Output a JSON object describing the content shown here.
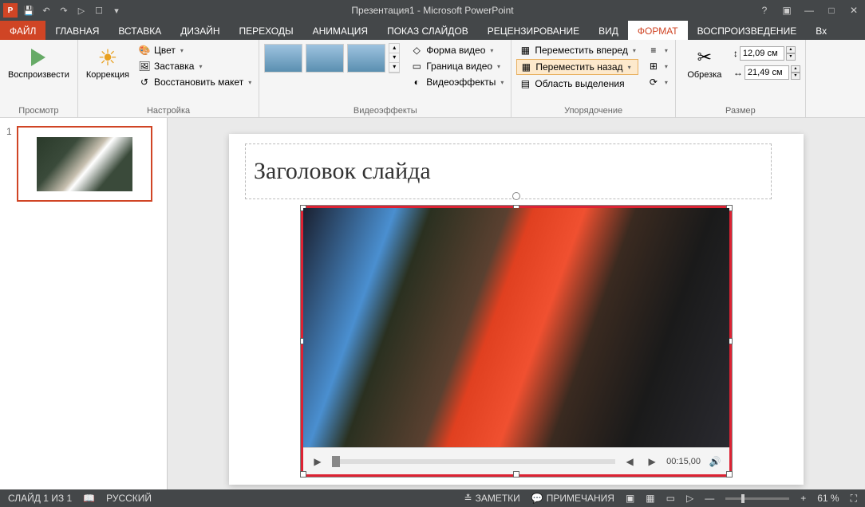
{
  "title": "Презентация1 - Microsoft PowerPoint",
  "qat": {
    "save": "💾",
    "undo": "↶",
    "redo": "↷",
    "start": "▷",
    "touch": "☐"
  },
  "tabs": [
    "ФАЙЛ",
    "ГЛАВНАЯ",
    "ВСТАВКА",
    "ДИЗАЙН",
    "ПЕРЕХОДЫ",
    "АНИМАЦИЯ",
    "ПОКАЗ СЛАЙДОВ",
    "РЕЦЕНЗИРОВАНИЕ",
    "ВИД",
    "ФОРМАТ",
    "ВОСПРОИЗВЕДЕНИЕ",
    "Вх"
  ],
  "active_tab": 9,
  "ribbon": {
    "group1": {
      "play": "Воспроизвести",
      "label": "Просмотр"
    },
    "group2": {
      "corrections": "Коррекция",
      "color": "Цвет",
      "poster": "Заставка",
      "reset": "Восстановить макет",
      "label": "Настройка"
    },
    "group3": {
      "shape": "Форма видео",
      "border": "Граница видео",
      "effects": "Видеоэффекты",
      "label": "Видеоэффекты"
    },
    "group4": {
      "forward": "Переместить вперед",
      "backward": "Переместить назад",
      "selection": "Область выделения",
      "label": "Упорядочение"
    },
    "group5": {
      "crop": "Обрезка",
      "height": "12,09 см",
      "width": "21,49 см",
      "label": "Размер"
    }
  },
  "thumbs": {
    "num": "1"
  },
  "slide": {
    "title": "Заголовок слайда",
    "video_time": "00:15,00"
  },
  "status": {
    "slide": "СЛАЙД 1 ИЗ 1",
    "lang": "РУССКИЙ",
    "notes": "ЗАМЕТКИ",
    "comments": "ПРИМЕЧАНИЯ",
    "zoom": "61 %"
  }
}
